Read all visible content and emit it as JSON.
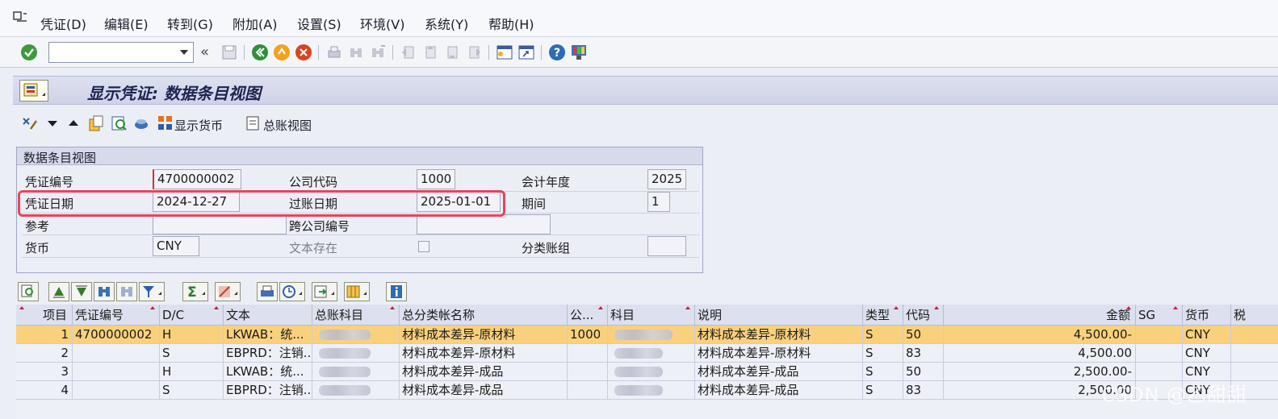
{
  "menu": {
    "items": [
      "凭证(D)",
      "编辑(E)",
      "转到(G)",
      "附加(A)",
      "设置(S)",
      "环境(V)",
      "系统(Y)",
      "帮助(H)"
    ]
  },
  "toolbar": {
    "command_value": ""
  },
  "title": "显示凭证: 数据条目视图",
  "app_toolbar": {
    "show_currency": "显示货币",
    "gl_view": "总账视图"
  },
  "panel": {
    "title": "数据条目视图",
    "doc_no_label": "凭证编号",
    "doc_no": "4700000002",
    "company_code_label": "公司代码",
    "company_code": "1000",
    "fiscal_year_label": "会计年度",
    "fiscal_year": "2025",
    "doc_date_label": "凭证日期",
    "doc_date": "2024-12-27",
    "posting_date_label": "过账日期",
    "posting_date": "2025-01-01",
    "period_label": "期间",
    "period": "1",
    "reference_label": "参考",
    "reference": "",
    "cross_company_label": "跨公司编号",
    "cross_company": "",
    "currency_label": "货币",
    "currency": "CNY",
    "text_exists_label": "文本存在",
    "ledger_group_label": "分类账组",
    "ledger_group": ""
  },
  "grid": {
    "headers": [
      "项目",
      "凭证编号",
      "D/C",
      "文本",
      "总账科目",
      "总分类帐名称",
      "公...",
      "科目",
      "说明",
      "类型",
      "代码",
      "金额",
      "SG",
      "货币",
      "税"
    ],
    "rows": [
      {
        "item": "1",
        "doc": "4700000002",
        "dc": "H",
        "text": "LKWAB：统...",
        "gl_name": "材料成本差异-原材料",
        "cc": "1000",
        "desc": "材料成本差异-原材料",
        "type": "S",
        "code": "50",
        "amount": "4,500.00-",
        "currency": "CNY"
      },
      {
        "item": "2",
        "doc": "",
        "dc": "S",
        "text": "EBPRD：注销...",
        "gl_name": "材料成本差异-原材料",
        "cc": "",
        "desc": "材料成本差异-原材料",
        "type": "S",
        "code": "83",
        "amount": "4,500.00",
        "currency": "CNY"
      },
      {
        "item": "3",
        "doc": "",
        "dc": "H",
        "text": "LKWAB：统...",
        "gl_name": "材料成本差异-成品",
        "cc": "",
        "desc": "材料成本差异-成品",
        "type": "S",
        "code": "50",
        "amount": "2,500.00-",
        "currency": "CNY"
      },
      {
        "item": "4",
        "doc": "",
        "dc": "S",
        "text": "EBPRD：注销...",
        "gl_name": "材料成本差异-成品",
        "cc": "",
        "desc": "材料成本差异-成品",
        "type": "S",
        "code": "83",
        "amount": "2,500.00",
        "currency": "CNY"
      }
    ]
  },
  "watermark": "CSDN @乙甜甜",
  "colors": {
    "highlight_border": "#e8445d",
    "selected_row": "#f9d17d",
    "title_text": "#1c2450"
  }
}
